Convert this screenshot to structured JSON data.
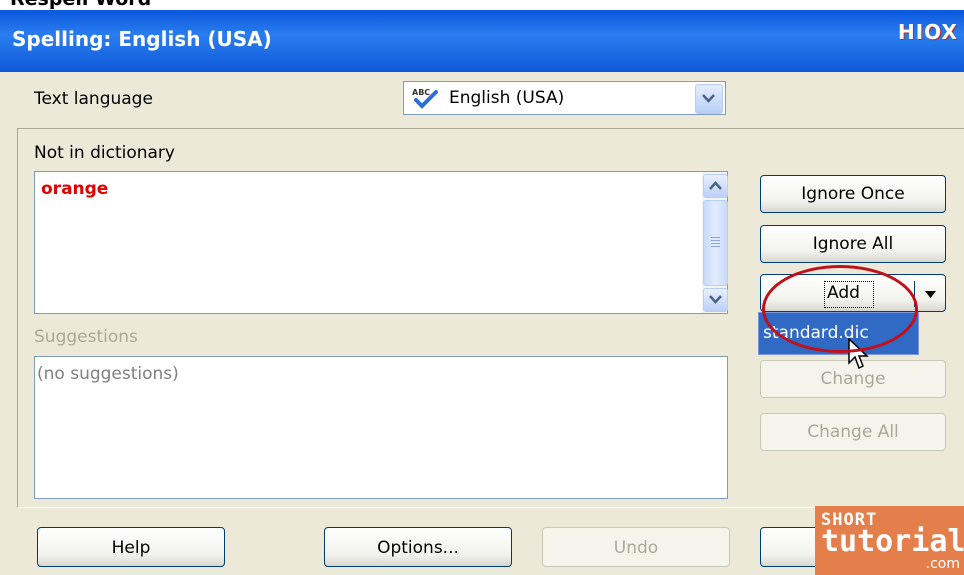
{
  "window": {
    "top_strip_text": "Respell Word",
    "title": "Spelling: English (USA)",
    "corner_badge": "HIOX"
  },
  "text_language": {
    "label": "Text language",
    "selected": "English (USA)"
  },
  "not_in_dictionary": {
    "label": "Not in dictionary",
    "word": "orange"
  },
  "suggestions": {
    "label": "Suggestions",
    "empty_text": "(no suggestions)"
  },
  "buttons": {
    "ignore_once": "Ignore Once",
    "ignore_all": "Ignore All",
    "add": "Add",
    "change": "Change",
    "change_all": "Change All",
    "help": "Help",
    "options": "Options...",
    "undo": "Undo"
  },
  "add_menu": {
    "items": [
      "standard.dic"
    ]
  },
  "watermark": {
    "line1": "SHORT",
    "line2": "tutorials",
    "line3": ".com"
  },
  "colors": {
    "title_bar": "#0a57dc",
    "misspelled_word": "#e00000",
    "menu_highlight": "#316ac5",
    "annotation_oval": "#c0101a",
    "watermark_bg": "#e47e4b"
  }
}
